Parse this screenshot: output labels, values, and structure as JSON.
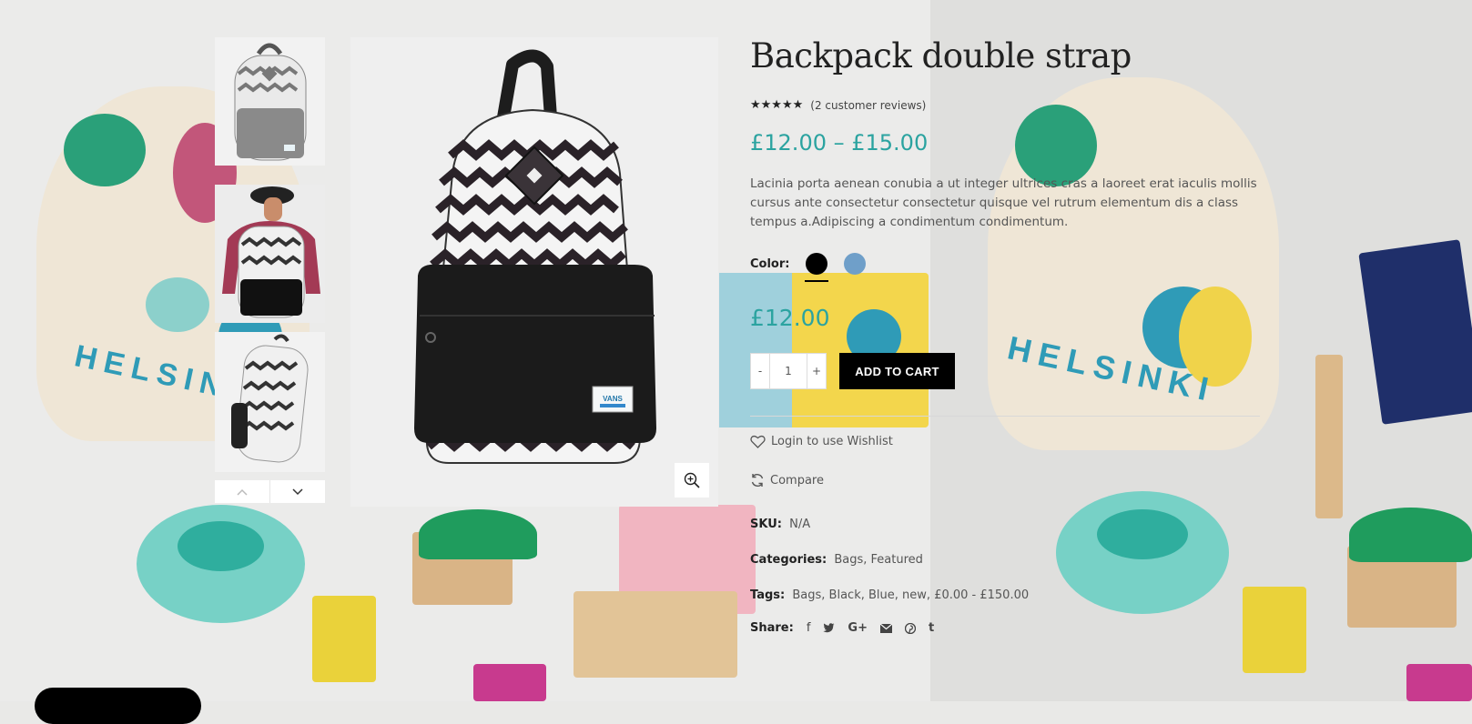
{
  "product": {
    "title": "Backpack double strap",
    "rating_stars": "★★★★★",
    "reviews": "(2 customer reviews)",
    "price_range": "£12.00 – £15.00",
    "description": "Lacinia porta aenean conubia a ut integer ultrices cras a laoreet erat iaculis mollis cursus ante consectetur consectetur quisque vel rutrum elementum dis a class tempus a.Adipiscing a condimentum condimentum.",
    "color_label": "Color:",
    "colors": [
      {
        "name": "Black",
        "hex": "#000000",
        "selected": true
      },
      {
        "name": "Blue",
        "hex": "#6f9fc9",
        "selected": false
      }
    ],
    "variation_price": "£12.00",
    "quantity": "1",
    "qty_minus": "-",
    "qty_plus": "+",
    "add_to_cart": "ADD TO CART",
    "wishlist": "Login to use Wishlist",
    "compare": "Compare",
    "sku_label": "SKU:",
    "sku_value": "N/A",
    "categories_label": "Categories:",
    "categories": [
      "Bags",
      "Featured"
    ],
    "tags_label": "Tags:",
    "tags": [
      "Bags",
      "Black",
      "Blue",
      "new",
      "£0.00 - £150.00"
    ],
    "share_label": "Share:"
  },
  "gallery": {
    "thumb_prev": "⌃",
    "thumb_next": "⌄"
  },
  "colors": {
    "accent": "#2ba3a0",
    "button": "#000000"
  },
  "icons": {
    "zoom": "zoom-in-icon",
    "wishlist": "heart-icon",
    "compare": "refresh-icon",
    "share": [
      "facebook-icon",
      "twitter-icon",
      "google-plus-icon",
      "email-icon",
      "pinterest-icon",
      "tumblr-icon"
    ]
  }
}
